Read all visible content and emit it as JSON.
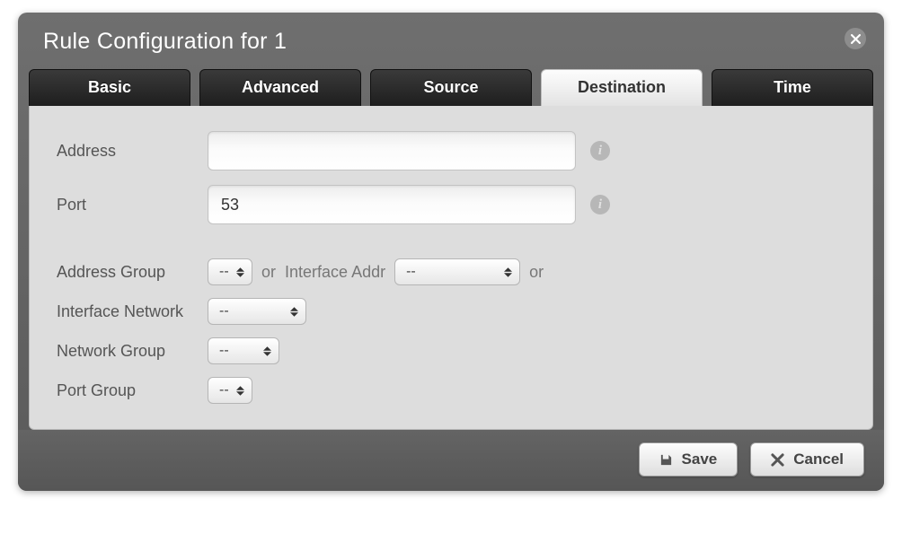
{
  "dialog": {
    "title": "Rule Configuration for 1"
  },
  "tabs": {
    "basic": "Basic",
    "advanced": "Advanced",
    "source": "Source",
    "destination": "Destination",
    "time": "Time"
  },
  "form": {
    "address_label": "Address",
    "address_value": "",
    "port_label": "Port",
    "port_value": "53",
    "address_group_label": "Address Group",
    "address_group_value": "--",
    "or_label_1": "or",
    "interface_addr_label": "Interface Addr",
    "interface_addr_value": "--",
    "or_label_2": "or",
    "interface_network_label": "Interface Network",
    "interface_network_value": "--",
    "network_group_label": "Network Group",
    "network_group_value": "--",
    "port_group_label": "Port Group",
    "port_group_value": "--"
  },
  "footer": {
    "save_label": "Save",
    "cancel_label": "Cancel"
  }
}
